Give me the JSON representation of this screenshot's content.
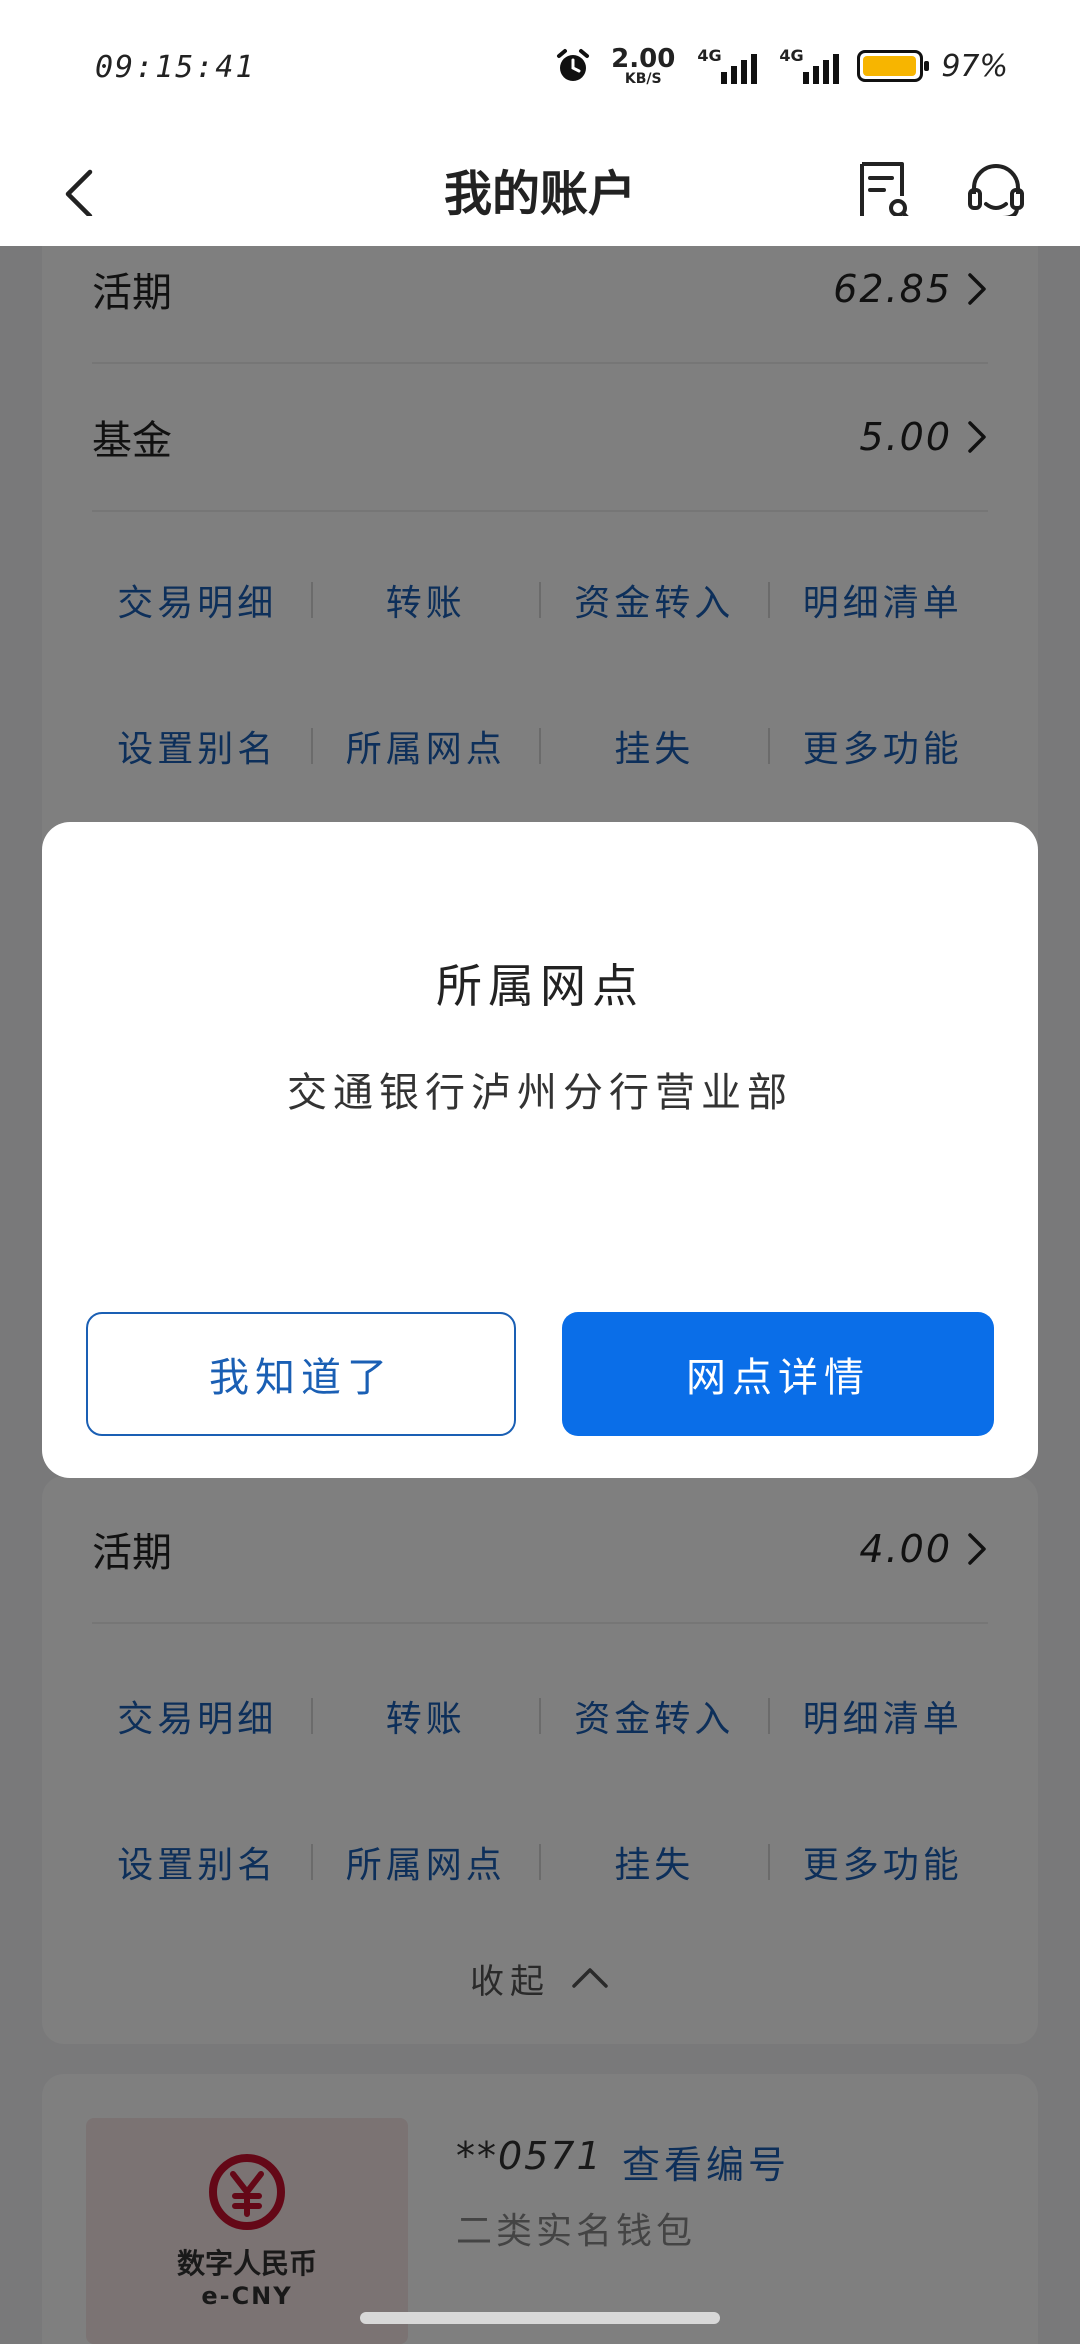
{
  "status_bar": {
    "time": "09:15:41",
    "net_speed_value": "2.00",
    "net_speed_unit": "KB/S",
    "signal1_label": "4G",
    "signal2_label": "4G",
    "battery_percent": "97%",
    "battery_level": 0.97
  },
  "header": {
    "title": "我的账户",
    "back_icon": "chevron-left-icon",
    "bill_icon": "bill-search-icon",
    "service_icon": "headset-icon"
  },
  "account1": {
    "rows": [
      {
        "label": "活期",
        "value": "62.85"
      },
      {
        "label": "基金",
        "value": "5.00"
      }
    ],
    "actions_row1": [
      "交易明细",
      "转账",
      "资金转入",
      "明细清单"
    ],
    "actions_row2": [
      "设置别名",
      "所属网点",
      "挂失",
      "更多功能"
    ]
  },
  "account2": {
    "rows": [
      {
        "label": "活期",
        "value": "4.00"
      }
    ],
    "actions_row1": [
      "交易明细",
      "转账",
      "资金转入",
      "明细清单"
    ],
    "actions_row2": [
      "设置别名",
      "所属网点",
      "挂失",
      "更多功能"
    ],
    "collapse_label": "收起"
  },
  "ecny": {
    "logo_text_cn": "数字人民币",
    "logo_text_en": "e-CNY",
    "wallet_number": "**0571",
    "view_number_link": "查看编号",
    "wallet_type": "二类实名钱包"
  },
  "dialog": {
    "title": "所属网点",
    "message": "交通银行泸州分行营业部",
    "ok_button": "我知道了",
    "detail_button": "网点详情"
  },
  "colors": {
    "primary": "#0a6ee8",
    "link": "#1a5fb4",
    "battery": "#f7b500"
  }
}
